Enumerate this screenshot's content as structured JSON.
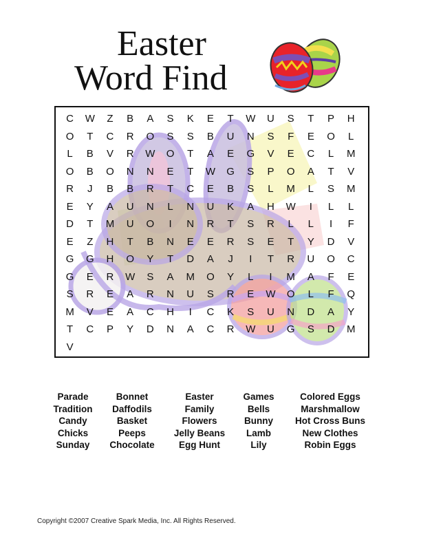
{
  "title": {
    "line1": "Easter",
    "line2": "Word Find"
  },
  "puzzle": {
    "rows": [
      "CWZBASKETWUSTP",
      "HOTCROSSBUNSFE",
      "OLLBVRWOTAEGVE",
      "CLMOBONNETWGSP",
      "OATVRJBBRTCEBS",
      "LMLSMEYAUNLNUK",
      "AHWILLDTMUOINR",
      "TSRLLIFEZHTBNE",
      "ERSETYDVGGHOYT",
      "DAJITRUOCGERWS",
      "AMOYLIMAFESREA",
      "RNUSREWOLFQMVE",
      "ACHICKSUNDAYTC",
      "PYDNACRWUGSDMV"
    ]
  },
  "word_list": {
    "columns": [
      [
        "Parade",
        "Tradition",
        "Candy",
        "Chicks",
        "Sunday"
      ],
      [
        "Bonnet",
        "Daffodils",
        "Basket",
        "Peeps",
        "Chocolate"
      ],
      [
        "Easter",
        "Family",
        "Flowers",
        "Jelly Beans",
        "Egg Hunt"
      ],
      [
        "Games",
        "Bells",
        "Bunny",
        "Lamb",
        "Lily"
      ],
      [
        "Colored Eggs",
        "Marshmallow",
        "Hot Cross Buns",
        "New Clothes",
        "Robin Eggs"
      ]
    ]
  },
  "footer": {
    "copyright": "Copyright ©2007  Creative Spark Media, Inc.  All Rights Reserved."
  },
  "colors": {
    "egg_red": "#e8232a",
    "egg_purple": "#7d4fb5",
    "egg_green": "#9ccb3c",
    "egg_yellow": "#f2d21b",
    "bunny_purple": "#b9a6e6"
  }
}
